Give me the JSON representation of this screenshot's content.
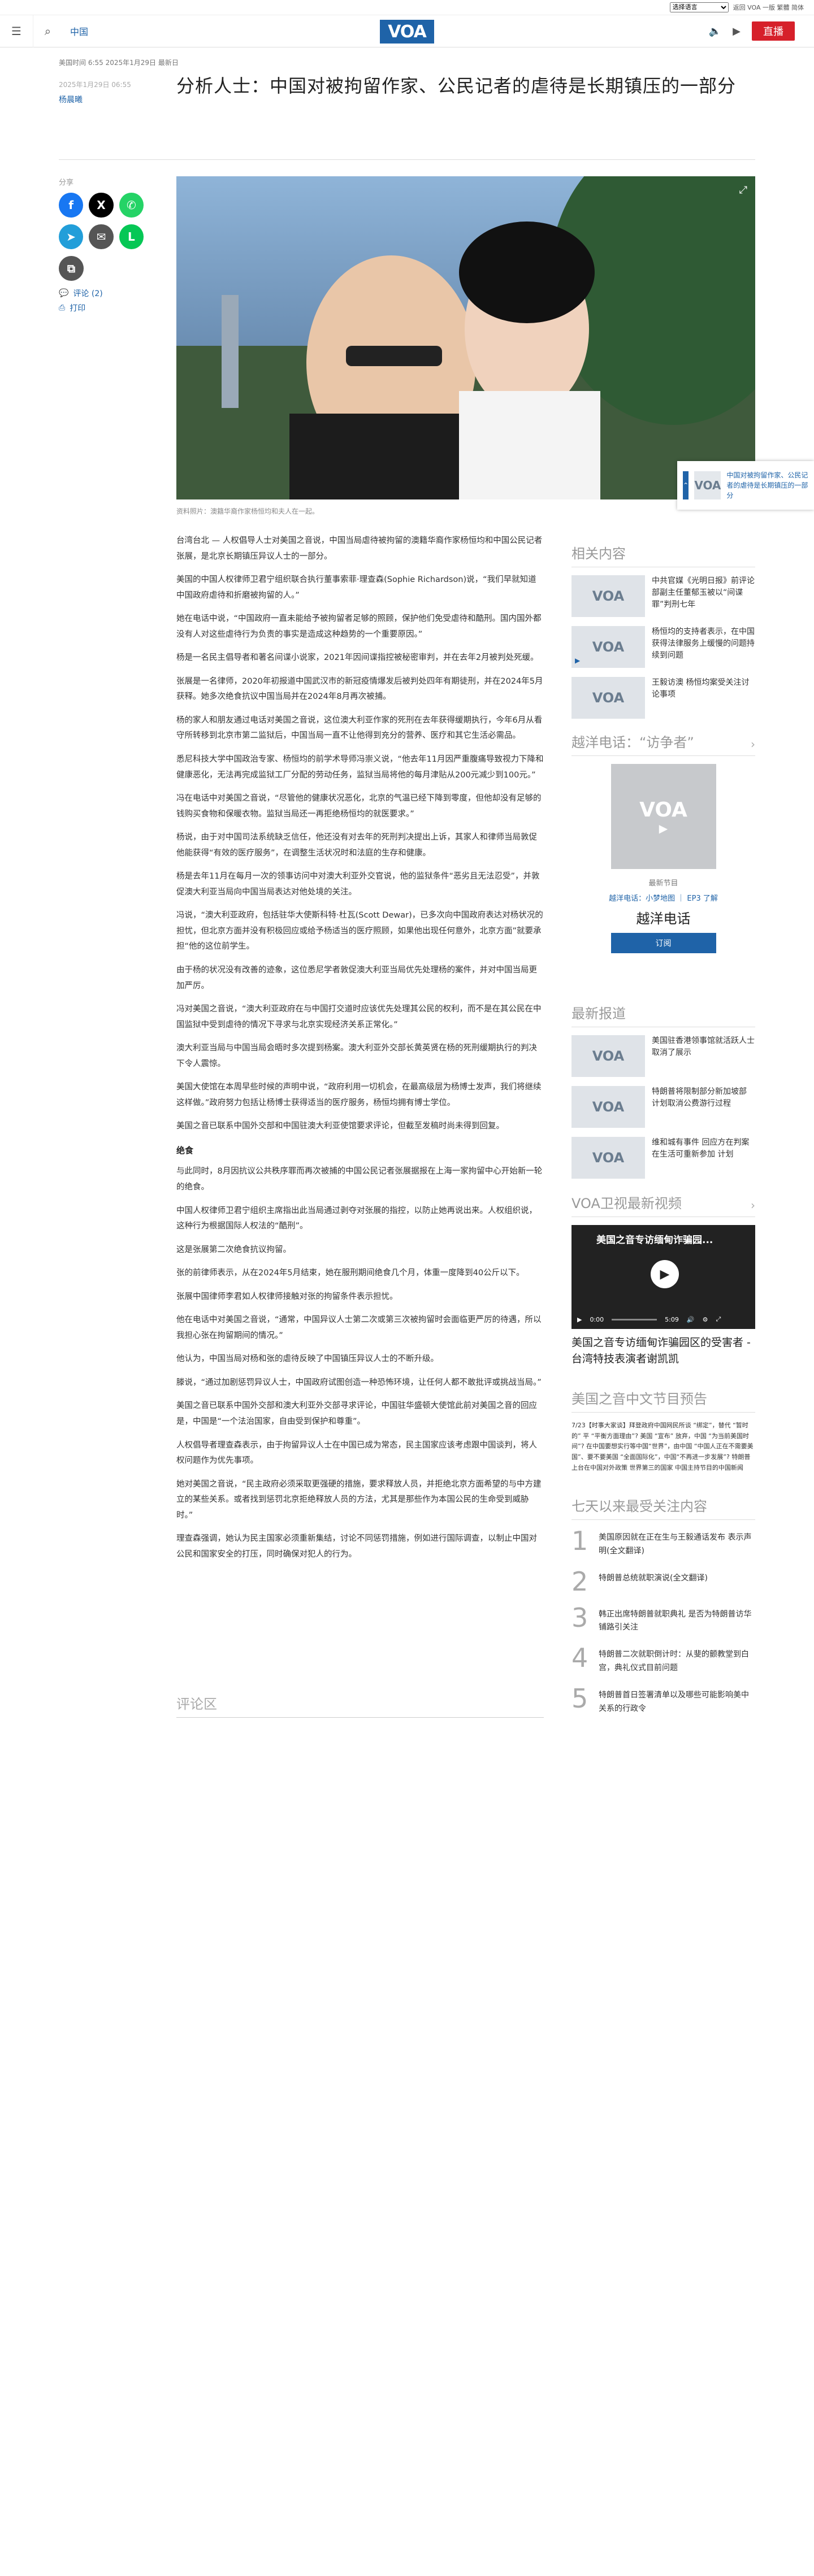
{
  "utility": {
    "language_select": "选择语言",
    "links": "返回 VOA 一版 繁體 简体"
  },
  "header": {
    "section": "中国",
    "logo": "VOA",
    "live": "直播"
  },
  "article": {
    "dates": "美国时间 6:55 2025年1月29日 最新日",
    "date_small": "2025年1月29日 06:55",
    "author": "杨晨曦",
    "title": "分析人士：中国对被拘留作家、公民记者的虐待是长期镇压的一部分",
    "share_label": "分享",
    "comments_label": "评论 (2)",
    "print_label": "打印",
    "caption": "资料照片：澳籍华裔作家杨恒均和夫人在一起。",
    "paragraphs": [
      "台湾台北 — 人权倡导人士对美国之音说，中国当局虐待被拘留的澳籍华裔作家杨恒均和中国公民记者张展，是北京长期镇压异议人士的一部分。",
      "美国的中国人权律师卫君宁组织联合执行董事索菲·理查森(Sophie Richardson)说，“我们早就知道中国政府虐待和折磨被拘留的人。”",
      "她在电话中说，“中国政府一直未能给予被拘留者足够的照顾，保护他们免受虐待和酷刑。国内国外都没有人对这些虐待行为负责的事实是造成这种趋势的一个重要原因。”",
      "杨是一名民主倡导者和著名间谍小说家，2021年因间谍指控被秘密审判，并在去年2月被判处死缓。",
      "张展是一名律师，2020年初报道中国武汉市的新冠疫情爆发后被判处四年有期徒刑，并在2024年5月获释。她多次绝食抗议中国当局并在2024年8月再次被捕。",
      "杨的家人和朋友通过电话对美国之音说，这位澳大利亚作家的死刑在去年获得缓期执行，今年6月从看守所转移到北京市第二监狱后，中国当局一直不让他得到充分的营养、医疗和其它生活必需品。",
      "悉尼科技大学中国政治专家、杨恒均的前学术导师冯崇义说，“他去年11月因严重腹痛导致视力下降和健康恶化，无法再完成监狱工厂分配的劳动任务，监狱当局将他的每月津贴从200元减少到100元。”",
      "冯在电话中对美国之音说，“尽管他的健康状况恶化，北京的气温已经下降到零度，但他却没有足够的钱购买食物和保暖衣物。监狱当局还一再拒绝杨恒均的就医要求。”",
      "杨说，由于对中国司法系统缺乏信任，他还没有对去年的死刑判决提出上诉，其家人和律师当局敦促他能获得“有效的医疗服务”，在调整生活状况时和法庭的生存和健康。",
      "杨是去年11月在每月一次的领事访问中对澳大利亚外交官说，他的监狱条件“恶劣且无法忍受”，并敦促澳大利亚当局向中国当局表达对他处境的关注。",
      "冯说，“澳大利亚政府，包括驻华大使斯科特·杜瓦(Scott Dewar)，已多次向中国政府表达对杨状况的担忧，但北京方面并没有积极回应或给予杨适当的医疗照顾，如果他出现任何意外，北京方面”就要承担“他的这位前学生。",
      "由于杨的状况没有改善的迹象，这位悉尼学者敦促澳大利亚当局优先处理杨的案件，并对中国当局更加严厉。",
      "冯对美国之音说，“澳大利亚政府在与中国打交道时应该优先处理其公民的权利，而不是在其公民在中国监狱中受到虐待的情况下寻求与北京实现经济关系正常化。”",
      "澳大利亚当局与中国当局会晤时多次提到杨案。澳大利亚外交部长黄英贤在杨的死刑缓期执行的判决下令人震惊。",
      "美国大使馆在本周早些时候的声明中说，“政府利用一切机会，在最高级层为杨博士发声，我们将继续这样做。”政府努力包括让杨博士获得适当的医疗服务，杨恒均拥有博士学位。",
      "美国之音已联系中国外交部和中国驻澳大利亚使馆要求评论，但截至发稿时尚未得到回复。"
    ],
    "subhead": "绝食",
    "paragraphs2": [
      "与此同时，8月因抗议公共秩序罪而再次被捕的中国公民记者张展据报在上海一家拘留中心开始新一轮的绝食。",
      "中国人权律师卫君宁组织主席指出此当局通过剥夺对张展的指控，以防止她再说出来。人权组织说，这种行为根据国际人权法的“酷刑”。",
      "这是张展第二次绝食抗议拘留。",
      "张的前律师表示，从在2024年5月结束，她在服刑期间绝食几个月，体重一度降到40公斤以下。",
      "张展中国律师李君如人权律师接触对张的拘留条件表示担忧。",
      "他在电话中对美国之音说，“通常，中国异议人士第二次或第三次被拘留时会面临更严厉的待遇，所以我担心张在拘留期间的情况。”",
      "他认为，中国当局对杨和张的虐待反映了中国镇压异议人士的不断升级。",
      "滕说，“通过加剧惩罚异议人士，中国政府试图创造一种恐怖环境，让任何人都不敢批评或挑战当局。”",
      "美国之音已联系中国外交部和澳大利亚外交部寻求评论，中国驻华盛顿大使馆此前对美国之音的回应是，中国是“一个法治国家，自由受到保护和尊重”。",
      "人权倡导者理查森表示，由于拘留异议人士在中国已成为常态，民主国家应该考虑跟中国谈判，将人权问题作为优先事项。",
      "她对美国之音说，“民主政府必须采取更强硬的措施，要求释放人员，并拒绝北京方面希望的与中方建立的某些关系。或者找到惩罚北京拒绝释放人员的方法，尤其是那些作为本国公民的生命受到威胁时。”",
      "理查森强调，她认为民主国家必须重新集结，讨论不同惩罚措施，例如进行国际调查，以制止中国对公民和国家安全的打压，同时确保对犯人的行为。"
    ],
    "comments_heading": "评论区"
  },
  "sidebar": {
    "related_heading": "相关内容",
    "related": [
      {
        "thumb": "VOA",
        "text": "中共官媒《光明日报》前评论部副主任董郁玉被以“间谍罪”判刑七年"
      },
      {
        "thumb": "VOA",
        "text": "杨恒均的支持者表示，在中国获得法律服务上缓慢的问题持续到问题"
      },
      {
        "thumb": "VOA",
        "text": "王毅访澳 杨恒均案受关注讨论事项"
      }
    ],
    "program_heading": "越洋电话：“访争者”",
    "program": {
      "img": "VOA",
      "label": "最新节目",
      "links": "越洋电话：小梦地图 ｜ EP3 了解",
      "title": "越洋电话",
      "subscribe": "订阅"
    },
    "latest_heading": "最新报道",
    "latest": [
      {
        "thumb": "VOA",
        "text": "美国驻香港领事馆就活跃人士取消了展示"
      },
      {
        "thumb": "VOA",
        "text": "特朗普将限制部分新加坡部 计划取消公费游行过程"
      },
      {
        "thumb": "VOA",
        "text": "维和城有事件 回应方在判案 在生活可重新参加 计划"
      }
    ],
    "video_heading": "VOA卫视最新视频",
    "video": {
      "title": "美国之音专访缅甸诈骗园...",
      "time_start": "0:00",
      "time_end": "5:09",
      "caption": "美国之音专访缅甸诈骗园区的受害者 - 台湾特技表演者谢凯凯"
    },
    "podcast_heading": "美国之音中文节目预告",
    "podcast_text": "7/23【时事大家谈】拜登政府中国网民所谈 “绑定”，替代 “暂时的” 平 “平衡方面理由”? 美国 “宣布” 放弃，中国 “为当前美国时间”? 在中国要想实行等中国“世界”，由中国 “中国人正在不需要美国”、要不要美国 “全面国际化”，中国“不再进一步发展”? 特朗普上台在中国对外政策 世界第三的国家 中国主持节目的中国新闻",
    "popular_heading": "七天以来最受关注内容",
    "popular": [
      {
        "n": "1",
        "t": "美国原因就在正在生与王毅通话发布 表示声明(全文翻译)"
      },
      {
        "n": "2",
        "t": "特朗普总统就职演说(全文翻译)"
      },
      {
        "n": "3",
        "t": "韩正出席特朗普就职典礼 是否为特朗普访华铺路引关注"
      },
      {
        "n": "4",
        "t": "特朗普二次就职倒计时：从斐的颤教堂到白宫，典礼仪式目前问题"
      },
      {
        "n": "5",
        "t": "特朗普首日签署清单以及哪些可能影响美中关系的行政令"
      }
    ]
  },
  "popup": {
    "text": "中国对被拘留作家、公民记者的虐待是长期镇压的一部分"
  },
  "colors": {
    "brand": "#1f63a8",
    "live": "#d6202a"
  }
}
